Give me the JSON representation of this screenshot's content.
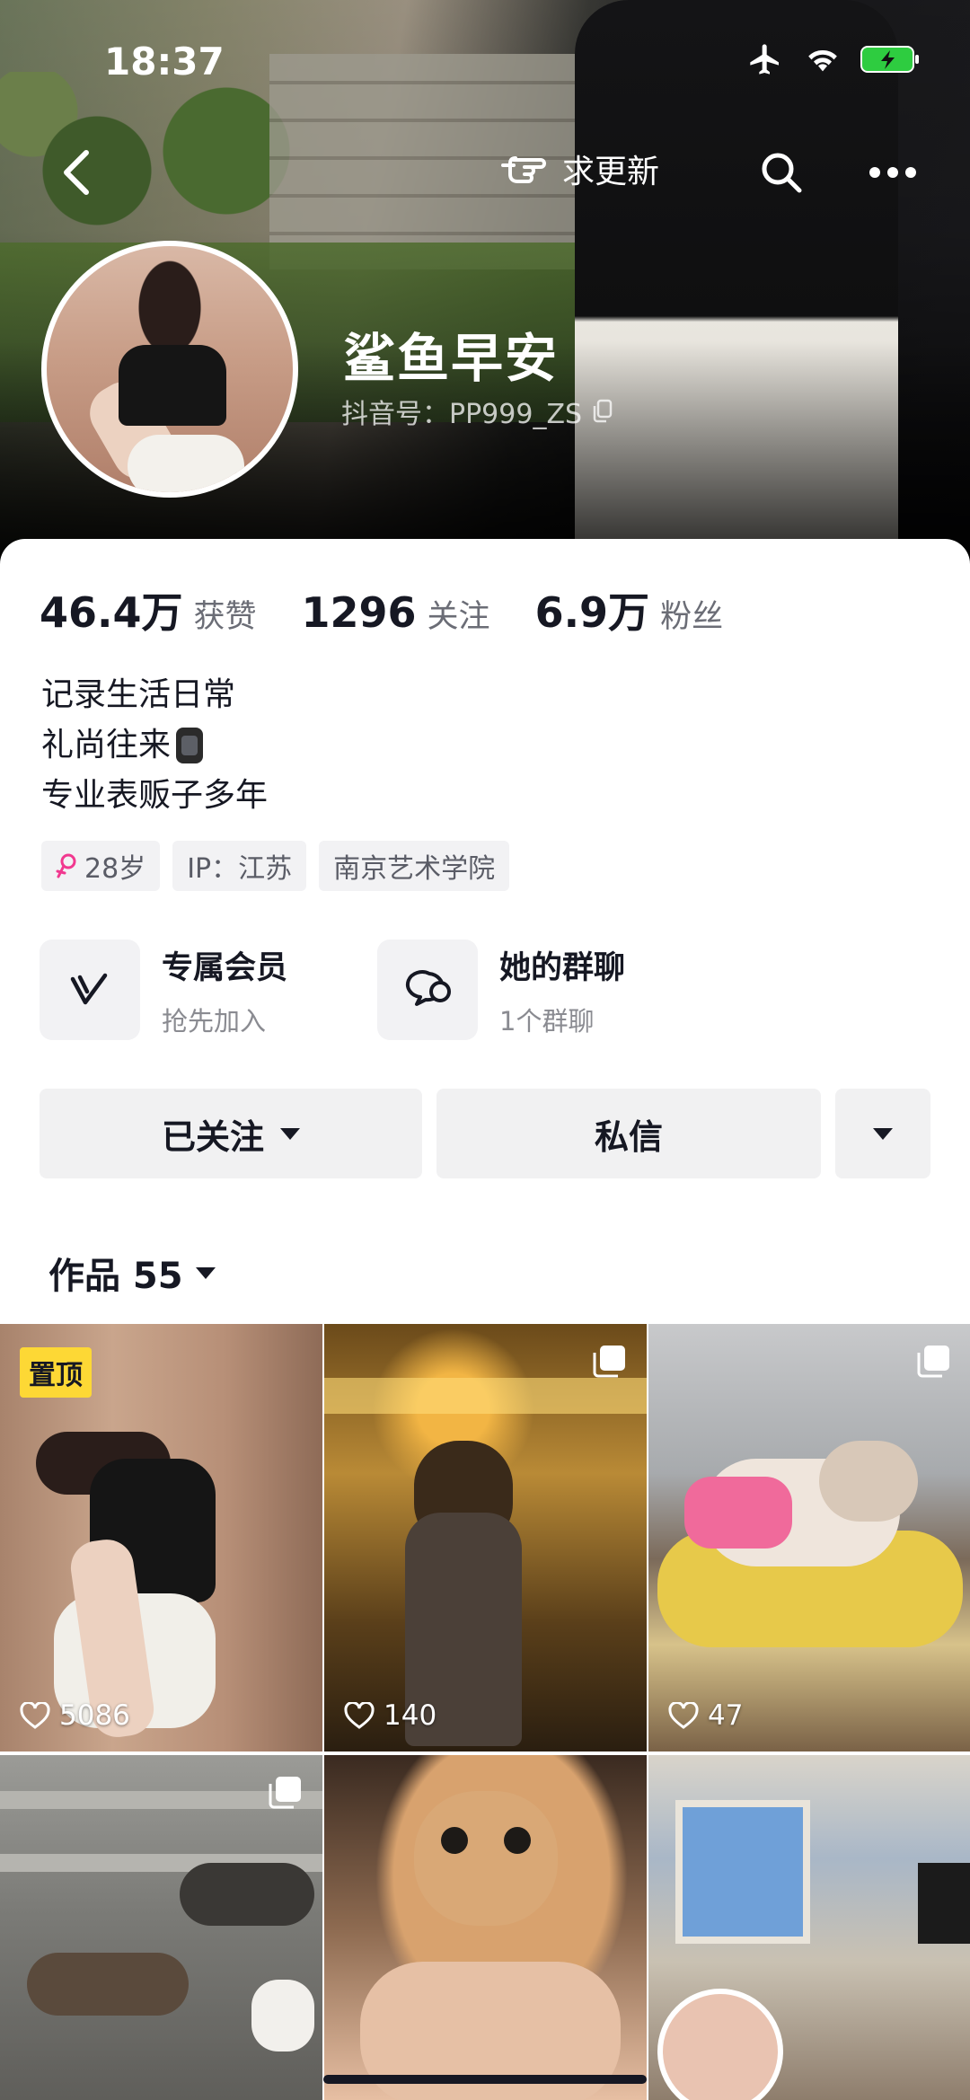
{
  "status_bar": {
    "time": "18:37"
  },
  "nav": {
    "update_label": "求更新"
  },
  "profile": {
    "name": "鲨鱼早安",
    "douyin_id": "抖音号：PP999_ZS"
  },
  "stats": [
    {
      "value": "46.4万",
      "label": "获赞"
    },
    {
      "value": "1296",
      "label": "关注"
    },
    {
      "value": "6.9万",
      "label": "粉丝"
    }
  ],
  "bio": [
    "记录生活日常",
    "礼尚往来",
    "专业表贩子多年"
  ],
  "tags": {
    "age": "28岁",
    "ip": "IP：江苏",
    "school": "南京艺术学院"
  },
  "features": [
    {
      "title": "专属会员",
      "subtitle": "抢先加入"
    },
    {
      "title": "她的群聊",
      "subtitle": "1个群聊"
    }
  ],
  "actions": {
    "follow_label": "已关注",
    "message_label": "私信"
  },
  "works": {
    "label": "作品 55"
  },
  "grid": [
    {
      "pinned_label": "置顶",
      "likes": "5086"
    },
    {
      "likes": "140"
    },
    {
      "likes": "47"
    },
    {},
    {},
    {}
  ],
  "colors": {
    "pinned_badge": "#fdd835",
    "female_icon": "#f1388f",
    "battery": "#2ecc40"
  },
  "icons": [
    "back-arrow-icon",
    "pointing-hand-icon",
    "search-icon",
    "more-icon",
    "copy-icon",
    "female-icon",
    "vip-v-icon",
    "group-chat-icon",
    "heart-icon",
    "multi-image-icon"
  ]
}
